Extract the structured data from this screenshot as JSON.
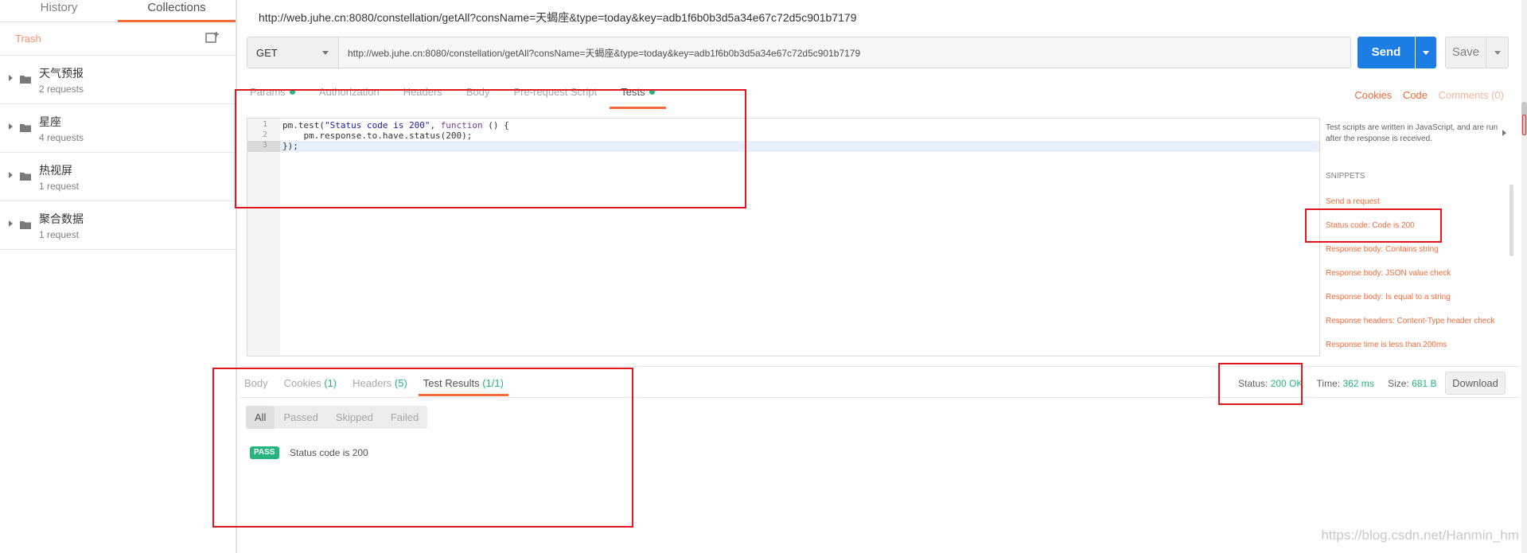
{
  "sidebar": {
    "tabs": [
      {
        "label": "History"
      },
      {
        "label": "Collections"
      }
    ],
    "trash_label": "Trash",
    "collections": [
      {
        "name": "天气预报",
        "count": "2 requests"
      },
      {
        "name": "星座",
        "count": "4 requests"
      },
      {
        "name": "热视屏",
        "count": "1 request"
      },
      {
        "name": "聚合数据",
        "count": "1 request"
      }
    ]
  },
  "request": {
    "title": "http://web.juhe.cn:8080/constellation/getAll?consName=天蝎座&type=today&key=adb1f6b0b3d5a34e67c72d5c901b7179",
    "method": "GET",
    "url": "http://web.juhe.cn:8080/constellation/getAll?consName=天蝎座&type=today&key=adb1f6b0b3d5a34e67c72d5c901b7179",
    "send_label": "Send",
    "save_label": "Save",
    "tabs": [
      {
        "label": "Params"
      },
      {
        "label": "Authorization"
      },
      {
        "label": "Headers"
      },
      {
        "label": "Body"
      },
      {
        "label": "Pre-request Script"
      },
      {
        "label": "Tests"
      }
    ],
    "links": {
      "cookies": "Cookies",
      "code": "Code",
      "comments": "Comments (0)"
    }
  },
  "editor": {
    "line_numbers": [
      "1",
      "2",
      "3"
    ],
    "line1": {
      "a": "pm.test(",
      "b": "\"Status code is 200\"",
      "c": ", ",
      "d": "function",
      "e": " () {"
    },
    "line2": "    pm.response.to.have.status(200);",
    "line3": "});"
  },
  "snippets": {
    "description": "Test scripts are written in JavaScript, and are run after the response is received.",
    "title": "SNIPPETS",
    "items": [
      "Send a request",
      "Status code: Code is 200",
      "Response body: Contains string",
      "Response body: JSON value check",
      "Response body: Is equal to a string",
      "Response headers: Content-Type header check",
      "Response time is less than 200ms"
    ]
  },
  "response": {
    "tabs": {
      "body": "Body",
      "cookies": "Cookies",
      "cookies_count": "(1)",
      "headers": "Headers",
      "headers_count": "(5)",
      "tests": "Test Results",
      "tests_count": "(1/1)"
    },
    "status_label": "Status:",
    "status_value": "200 OK",
    "time_label": "Time:",
    "time_value": "362 ms",
    "size_label": "Size:",
    "size_value": "681 B",
    "download_label": "Download",
    "filters": [
      "All",
      "Passed",
      "Skipped",
      "Failed"
    ],
    "results": [
      {
        "badge": "PASS",
        "name": "Status code is 200"
      }
    ]
  },
  "watermark": "https://blog.csdn.net/Hanmin_hm",
  "colors": {
    "accent": "#f26b3a",
    "send": "#1c7ee4",
    "pass": "#26b47f",
    "annotation": "#e0171e"
  }
}
